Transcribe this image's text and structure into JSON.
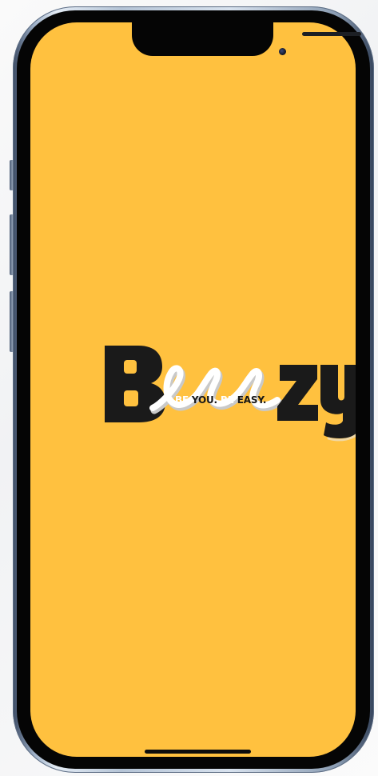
{
  "device": {
    "frame_color": "#9fb1c8",
    "screen_background": "#ffc13f"
  },
  "splash": {
    "brand_letters": [
      "B",
      "e",
      "e",
      "z",
      "y"
    ],
    "brand_letter_color": "#1a1a1a",
    "brand_accent_color": "#ffffff",
    "tagline_parts": [
      {
        "text": "BE ",
        "color": "white"
      },
      {
        "text": "YOU.",
        "color": "dark"
      },
      {
        "text": " BE ",
        "color": "white"
      },
      {
        "text": "EASY.",
        "color": "dark"
      }
    ]
  }
}
